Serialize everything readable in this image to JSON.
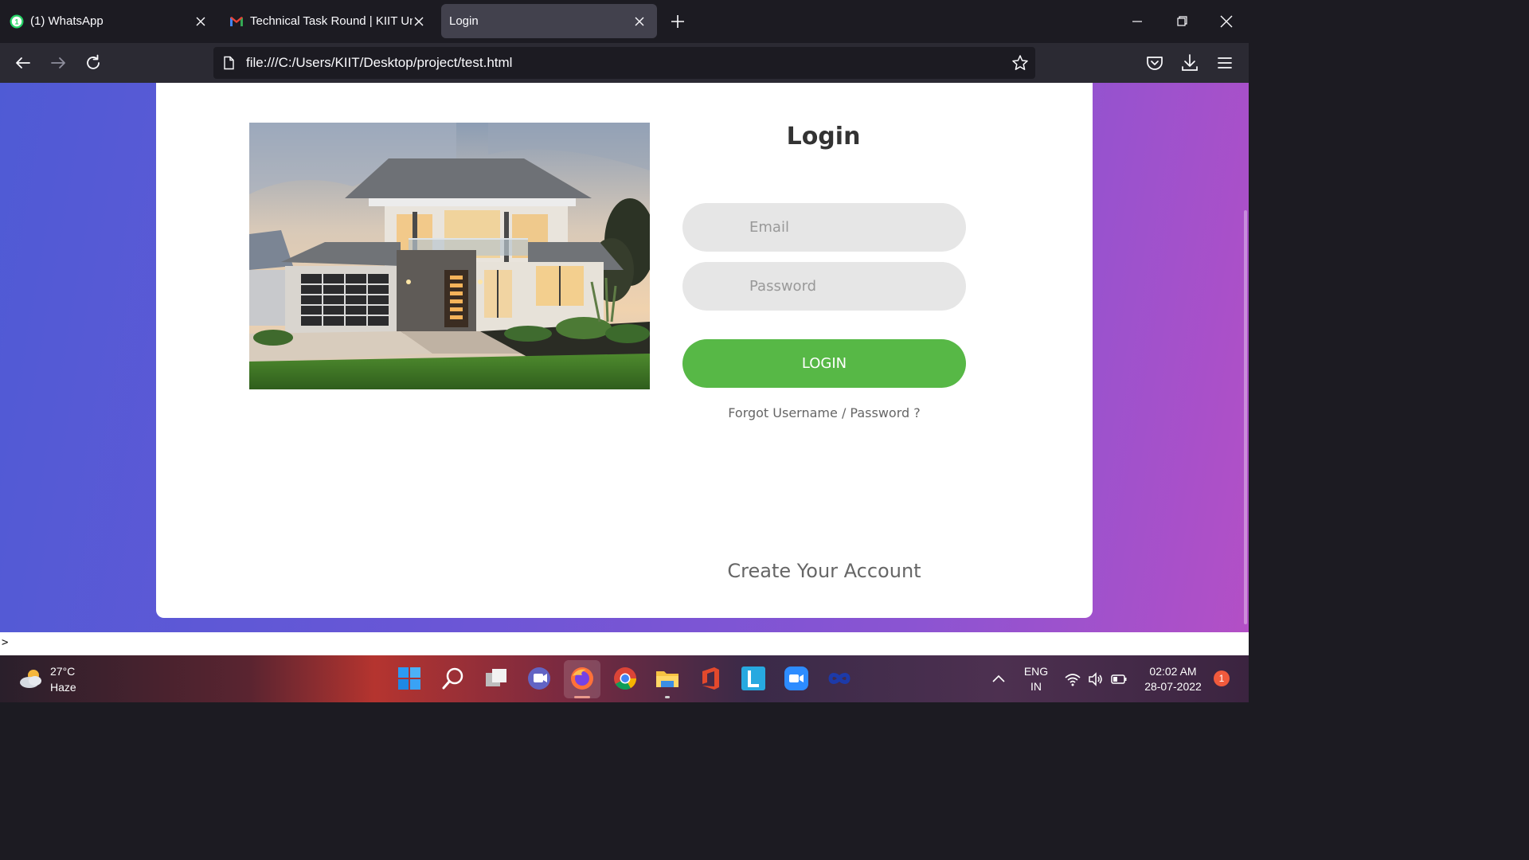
{
  "browser": {
    "tabs": [
      {
        "title": "(1) WhatsApp",
        "favicon": "whatsapp-icon",
        "active": false
      },
      {
        "title": "Technical Task Round | KIIT Univ",
        "favicon": "gmail-icon",
        "active": false
      },
      {
        "title": "Login",
        "favicon": "",
        "active": true
      }
    ],
    "url": "file:///C:/Users/KIIT/Desktop/project/test.html"
  },
  "login": {
    "title": "Login",
    "email_placeholder": "Email",
    "password_placeholder": "Password",
    "button_label": "LOGIN",
    "forgot_label": "Forgot Username / Password ?",
    "create_label": "Create Your Account",
    "accent_color": "#57b846"
  },
  "console": {
    "prompt": ">"
  },
  "taskbar": {
    "weather_temp": "27°C",
    "weather_desc": "Haze",
    "language": "ENG",
    "region": "IN",
    "time": "02:02 AM",
    "date": "28-07-2022",
    "notification_count": "1",
    "apps": [
      "windows-start-icon",
      "search-icon",
      "task-view-icon",
      "teams-chat-icon",
      "firefox-icon",
      "chrome-icon",
      "file-explorer-icon",
      "office-icon",
      "l-app-icon",
      "zoom-icon",
      "infinity-app-icon"
    ]
  }
}
